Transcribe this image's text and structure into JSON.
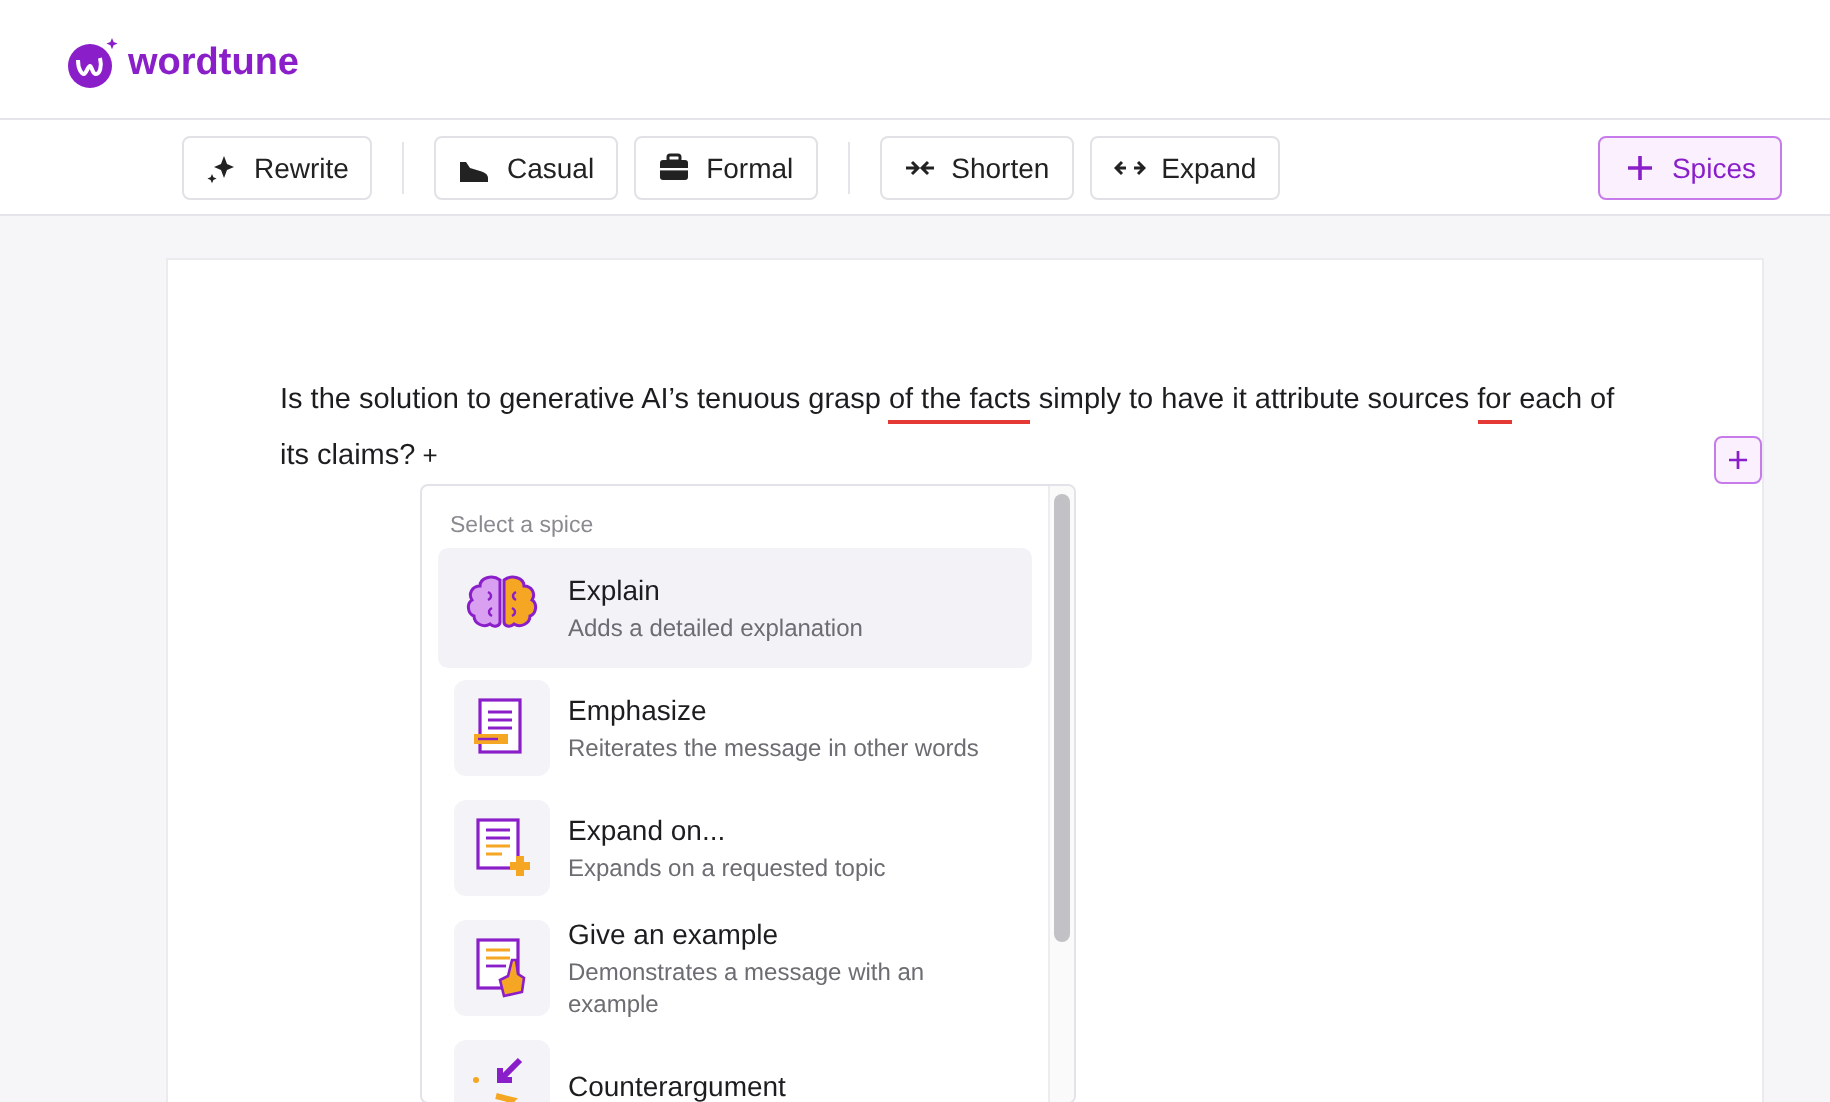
{
  "brand": {
    "name": "wordtune"
  },
  "toolbar": {
    "groups": [
      [
        {
          "label": "Rewrite",
          "kind": "sparkle",
          "highlighted": false
        }
      ],
      [
        {
          "label": "Casual",
          "kind": "sneaker",
          "highlighted": false
        },
        {
          "label": "Formal",
          "kind": "briefcase",
          "highlighted": false
        }
      ],
      [
        {
          "label": "Shorten",
          "kind": "shorten",
          "highlighted": false
        },
        {
          "label": "Expand",
          "kind": "expand",
          "highlighted": false
        }
      ],
      [
        {
          "label": "Spices",
          "kind": "plus",
          "highlighted": true
        }
      ]
    ]
  },
  "editor": {
    "segments": [
      {
        "text": "Is the solution to generative AI’s tenuous grasp ",
        "flagged": false
      },
      {
        "text": "of the facts",
        "flagged": true
      },
      {
        "text": " simply to have it attribute sources ",
        "flagged": false
      },
      {
        "text": "for",
        "flagged": true
      },
      {
        "text": " each of its claims?",
        "flagged": false
      }
    ],
    "add_marker": "+"
  },
  "spice_menu": {
    "heading": "Select a spice",
    "items": [
      {
        "kind": "brain",
        "title": "Explain",
        "description": "Adds a detailed explanation",
        "selected": true
      },
      {
        "kind": "document",
        "title": "Emphasize",
        "description": "Reiterates the message in other words",
        "selected": false
      },
      {
        "kind": "document-plus",
        "title": "Expand on...",
        "description": "Expands on a requested topic",
        "selected": false
      },
      {
        "kind": "document-hand",
        "title": "Give an example",
        "description": "Demonstrates a message with an example",
        "selected": false
      },
      {
        "kind": "arrows-in",
        "title": "Counterargument",
        "selected": false
      }
    ]
  }
}
